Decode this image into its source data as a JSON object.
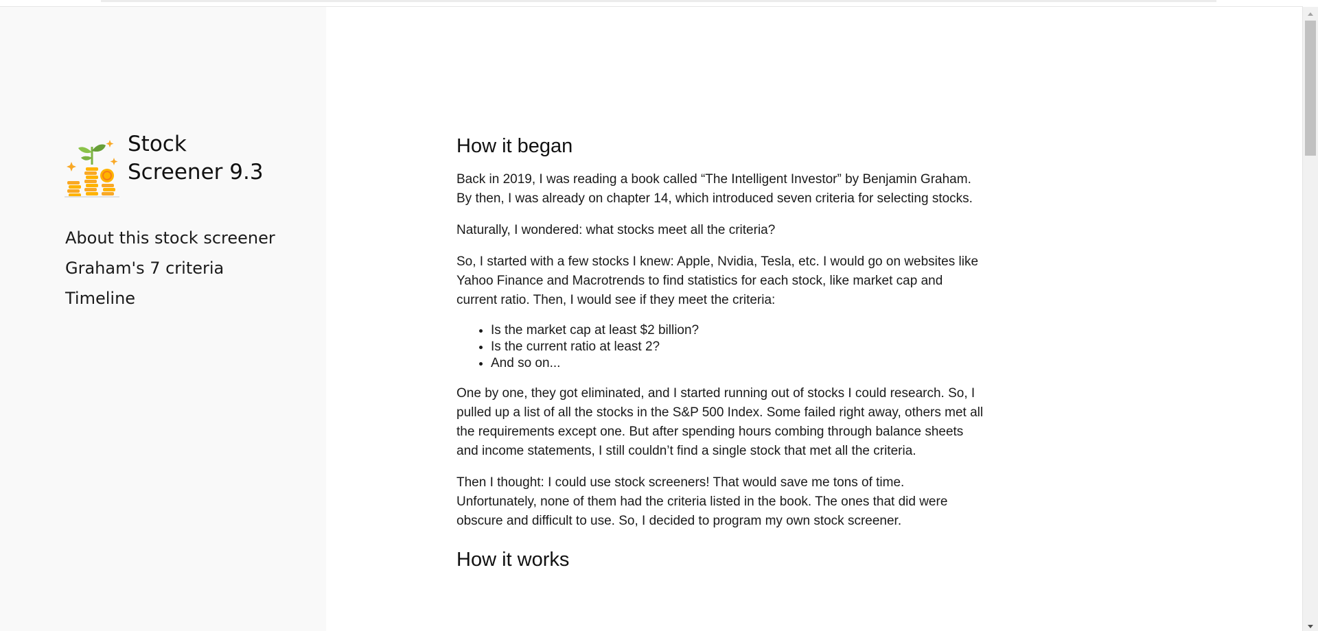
{
  "brand": {
    "logo_icon": "coins-growth-icon",
    "title": "Stock Screener 9.3"
  },
  "sidebar": {
    "items": [
      {
        "label": "About this stock screener"
      },
      {
        "label": "Graham's 7 criteria"
      },
      {
        "label": "Timeline"
      }
    ]
  },
  "content": {
    "section1": {
      "heading": "How it began",
      "p1": "Back in 2019, I was reading a book called “The Intelligent Investor” by Benjamin Graham. By then, I was already on chapter 14, which introduced seven criteria for selecting stocks.",
      "p2": "Naturally, I wondered: what stocks meet all the criteria?",
      "p3": "So, I started with a few stocks I knew: Apple, Nvidia, Tesla, etc. I would go on websites like Yahoo Finance and Macrotrends to find statistics for each stock, like market cap and current ratio. Then, I would see if they meet the criteria:",
      "bullets": [
        "Is the market cap at least $2 billion?",
        "Is the current ratio at least 2?",
        "And so on..."
      ],
      "p4": "One by one, they got eliminated, and I started running out of stocks I could research. So, I pulled up a list of all the stocks in the S&P 500 Index. Some failed right away, others met all the requirements except one. But after spending hours combing through balance sheets and income statements, I still couldn’t find a single stock that met all the criteria.",
      "p5": "Then I thought: I could use stock screeners! That would save me tons of time. Unfortunately, none of them had the criteria listed in the book. The ones that did were obscure and difficult to use. So, I decided to program my own stock screener."
    },
    "section2": {
      "heading": "How it works"
    }
  },
  "colors": {
    "sidebar_bg": "#f9f9f9",
    "coin_gold": "#f9a825",
    "sprout_green": "#7cb342"
  }
}
